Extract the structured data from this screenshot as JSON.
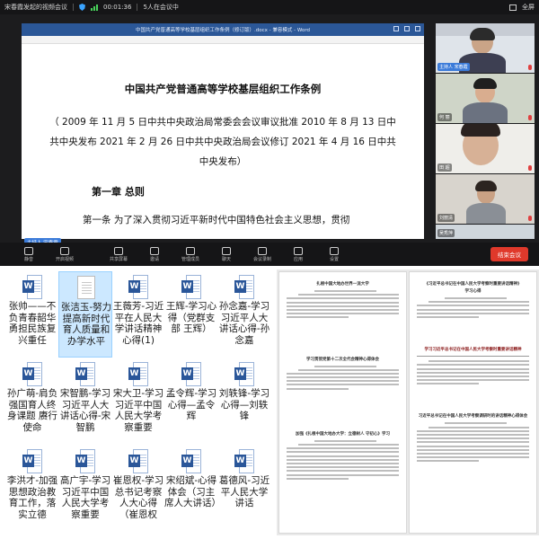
{
  "meeting": {
    "topbar": {
      "meeting_name": "宋春霞发起的视频会议",
      "timer": "00:01:36",
      "attendees": "5人在会议中",
      "fullscreen_label": "全屏"
    },
    "document": {
      "window_title": "中国共产党普通高等学校基层组织工作条例（修订版）.docx - 兼容模式 - Word",
      "title": "中国共产党普通高等学校基层组织工作条例",
      "subtitle": "（ 2009 年 11 月 5 日中共中央政治局常委会会议审议批准 2010 年 8 月 13 日中共中央发布 2021 年 2 月 26 日中共中央政治局会议修订 2021 年 4 月 16 日中共中央发布）",
      "chapter": "第一章 总则",
      "article": "第一条 为了深入贯彻习近平新时代中国特色社会主义思想，贯彻"
    },
    "host_label_main": "主持人",
    "host_name_main": "宋春霞",
    "participants": [
      {
        "name": "宋春霞",
        "host_label": "主持人"
      },
      {
        "name": "何 丽"
      },
      {
        "name": "田 超"
      },
      {
        "name": "刘丽清"
      },
      {
        "name": "吴秀萍"
      }
    ],
    "toolbar": {
      "mute": "静音",
      "video": "开启视频",
      "share": "共享屏幕",
      "invite": "邀请",
      "members": "管理成员",
      "chat": "聊天",
      "record": "会议录制",
      "apps": "应用",
      "settings": "设置",
      "end": "结束会议"
    }
  },
  "files": {
    "items": [
      {
        "name": "张帅——不负青春韶华勇担民族复兴重任",
        "icon": "word-doc-icon"
      },
      {
        "name": "张洁玉-努力提高新时代育人质量和办学水平",
        "icon": "plain-doc-icon",
        "selected": true
      },
      {
        "name": "王薇芳-习近平在人民大学讲话精神心得(1)",
        "icon": "word-doc-icon"
      },
      {
        "name": "王辉-学习心得（党群支部 王辉）",
        "icon": "word-doc-icon"
      },
      {
        "name": "孙念嘉-学习习近平人大讲话心得-孙念嘉",
        "icon": "word-doc-icon"
      },
      {
        "name": "孙广萌-肩负强国育人终身课题 赓行使命",
        "icon": "word-doc-icon"
      },
      {
        "name": "宋智鹏-学习习近平人大讲话心得-宋智鹏",
        "icon": "word-doc-icon"
      },
      {
        "name": "宋大卫-学习习近平中国人民大学考察重要",
        "icon": "word-doc-icon"
      },
      {
        "name": "孟令辉-学习心得—孟令辉",
        "icon": "word-doc-icon"
      },
      {
        "name": "刘轶锋-学习心得—刘轶锋",
        "icon": "word-doc-icon"
      },
      {
        "name": "李洪才-加强思想政治教育工作，落实立德",
        "icon": "word-doc-icon"
      },
      {
        "name": "高广宇-学习习近平中国人民大学考察重要",
        "icon": "word-doc-icon"
      },
      {
        "name": "崔恩权-学习总书记考察人大心得（崔恩权",
        "icon": "word-doc-icon"
      },
      {
        "name": "宋绍斌-心得体会（习主席人大讲话）",
        "icon": "word-doc-icon"
      },
      {
        "name": "葛德风-习近平人民大学讲话",
        "icon": "word-doc-icon"
      }
    ]
  },
  "pages": {
    "left": {
      "heading_1": "扎根中国大地办世界一流大学",
      "heading_2": "学习贯彻党第十二次全代会精神心得体会",
      "heading_3": "加强《扎根中国大地办大学：立德树人 守初心》学习"
    },
    "right": {
      "heading_1": "《习近平总书记在中国人民大学考察时重要讲话精神》",
      "heading_1b": "学习心得",
      "heading_2": "学习习近平总书记在中国人民大学考察时重要讲话精神",
      "heading_3": "习近平总书记在中国人民大学考察调研时的讲话精神心得体会"
    }
  }
}
